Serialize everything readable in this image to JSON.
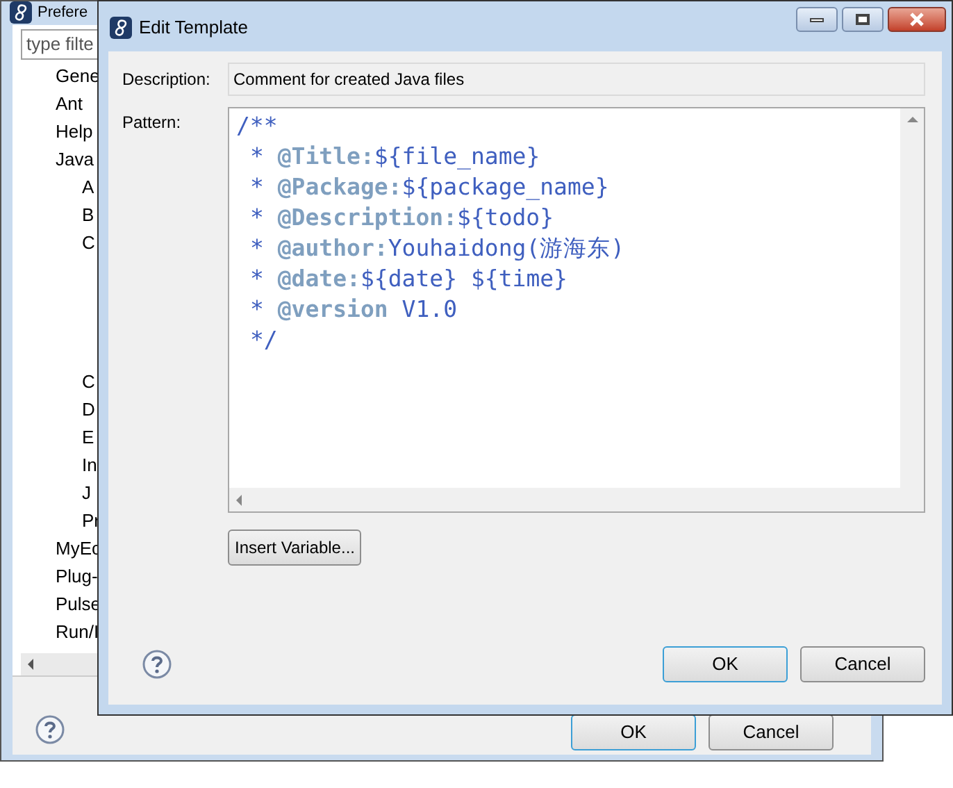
{
  "preferences_window": {
    "title": "Prefere",
    "filter": {
      "placeholder": "type filte"
    },
    "tree": [
      {
        "label": "Gene"
      },
      {
        "label": "Ant"
      },
      {
        "label": "Help"
      },
      {
        "label": "Java",
        "children": [
          {
            "label": "A"
          },
          {
            "label": "B"
          },
          {
            "label": "C"
          },
          {
            "label": "C",
            "gap": true
          },
          {
            "label": "D"
          },
          {
            "label": "E"
          },
          {
            "label": "In"
          },
          {
            "label": "J"
          },
          {
            "label": "Pr"
          }
        ]
      },
      {
        "label": "MyEc"
      },
      {
        "label": "Plug-"
      },
      {
        "label": "Pulse"
      },
      {
        "label": "Run/I"
      }
    ],
    "buttons": [
      {
        "label": "OK",
        "default": true
      },
      {
        "label": "Cancel",
        "default": false
      }
    ]
  },
  "dialog": {
    "title": "Edit Template",
    "description": {
      "label": "Description:",
      "value": "Comment for created Java files"
    },
    "pattern": {
      "label": "Pattern:",
      "lines": [
        {
          "kind": "open",
          "text": "/**"
        },
        {
          "kind": "tag",
          "star": "*",
          "tag": "@Title:",
          "value": "${file_name}"
        },
        {
          "kind": "tag",
          "star": "*",
          "tag": "@Package:",
          "value": "${package_name}"
        },
        {
          "kind": "tag",
          "star": "*",
          "tag": "@Description:",
          "value": "${todo}"
        },
        {
          "kind": "tag",
          "star": "*",
          "tag": "@author:",
          "value": "Youhaidong(游海东)"
        },
        {
          "kind": "tag",
          "star": "*",
          "tag": "@date:",
          "value": "${date} ${time}"
        },
        {
          "kind": "tag",
          "star": "*",
          "tag": "@version",
          "value": "V1.0"
        },
        {
          "kind": "close",
          "text": "*/"
        }
      ]
    },
    "insert_button": "Insert Variable...",
    "buttons": [
      {
        "label": "OK",
        "default": true
      },
      {
        "label": "Cancel",
        "default": false
      }
    ]
  }
}
